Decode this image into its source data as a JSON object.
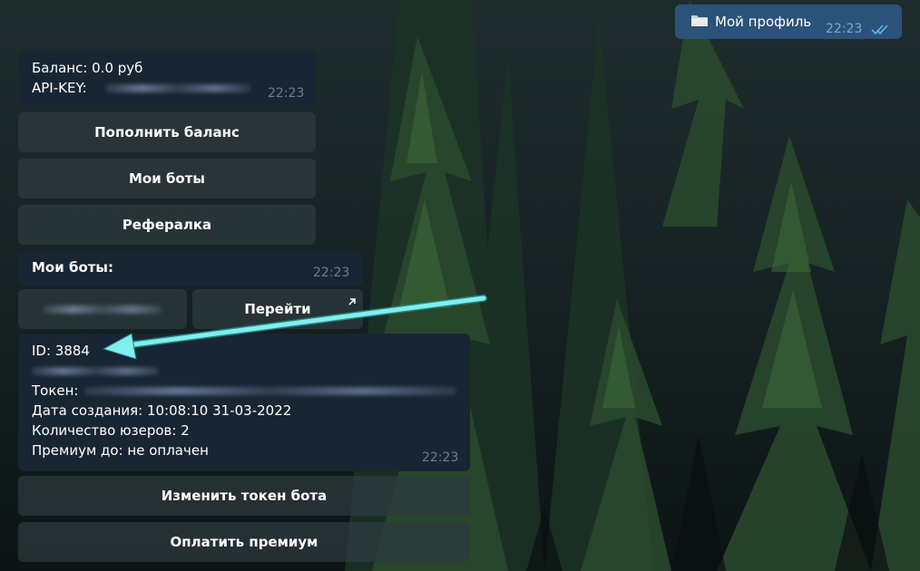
{
  "outgoing": {
    "icon": "folder-icon",
    "text": "Мой профиль",
    "time": "22:23",
    "status_icon": "double-check-icon"
  },
  "profile_message": {
    "balance_line": "Баланс: 0.0 руб",
    "api_key_label": "API-KEY:",
    "time": "22:23"
  },
  "profile_keyboard": {
    "buttons": [
      "Пополнить баланс",
      "Мои боты",
      "Рефералка"
    ]
  },
  "bots_message": {
    "title": "Мои боты:",
    "time": "22:23"
  },
  "bots_keyboard": {
    "goto_label": "Перейти",
    "goto_icon": "external-link-arrow-icon"
  },
  "bot_info_message": {
    "id_line": "ID: 3884",
    "token_label": "Токен:",
    "created_line": "Дата создания: 10:08:10 31-03-2022",
    "users_line": "Количество юзеров: 2",
    "premium_line": "Премиум до:  не оплачен",
    "time": "22:23"
  },
  "bot_keyboard": {
    "buttons": [
      "Изменить токен бота",
      "Оплатить премиум"
    ]
  },
  "annotation": {
    "type": "arrow",
    "color": "#7ff0ee"
  },
  "colors": {
    "incoming_bubble": "#182533",
    "outgoing_bubble": "#2b5278",
    "time_text": "#6d7f8f",
    "check_mark": "#64b5ef"
  }
}
